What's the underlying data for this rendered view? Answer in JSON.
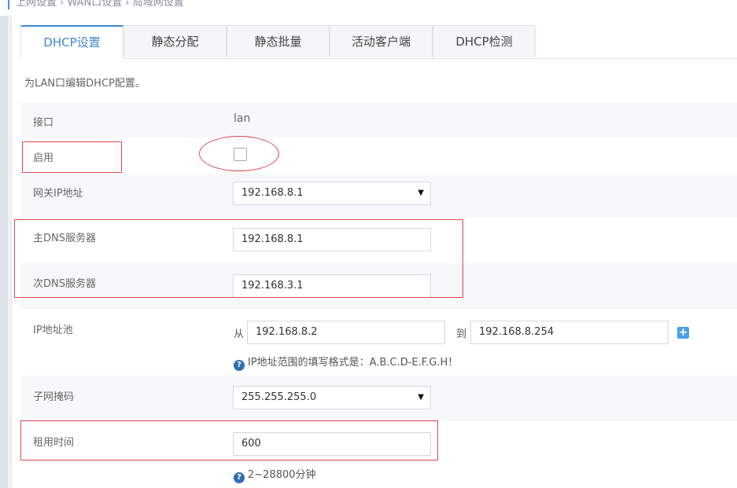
{
  "breadcrumb": {
    "text": "上网设置  ›  WAN口设置  ›  局域网设置"
  },
  "tabs": [
    {
      "label": "DHCP设置"
    },
    {
      "label": "静态分配"
    },
    {
      "label": "静态批量"
    },
    {
      "label": "活动客户端"
    },
    {
      "label": "DHCP检测"
    }
  ],
  "description": "为LAN口编辑DHCP配置。",
  "fields": {
    "interface": {
      "label": "接口",
      "value": "lan"
    },
    "enable": {
      "label": "启用",
      "checked": false
    },
    "gateway": {
      "label": "网关IP地址",
      "value": "192.168.8.1"
    },
    "primary_dns": {
      "label": "主DNS服务器",
      "value": "192.168.8.1"
    },
    "secondary_dns": {
      "label": "次DNS服务器",
      "value": "192.168.3.1"
    },
    "ip_pool": {
      "label": "IP地址池",
      "from_label": "从",
      "from_value": "192.168.8.2",
      "to_label": "到",
      "to_value": "192.168.8.254",
      "add_symbol": "+",
      "hint": "IP地址范围的填写格式是：A.B.C.D-E.F.G.H！"
    },
    "subnet_mask": {
      "label": "子网掩码",
      "value": "255.255.255.0"
    },
    "lease_time": {
      "label": "租用时间",
      "value": "600",
      "hint": "2~28800分钟"
    }
  },
  "icons": {
    "help": "?",
    "dropdown": "▼"
  },
  "colors": {
    "accent": "#3f87d6",
    "annotation": "#e0474c",
    "help_icon": "#2f6fb0"
  }
}
